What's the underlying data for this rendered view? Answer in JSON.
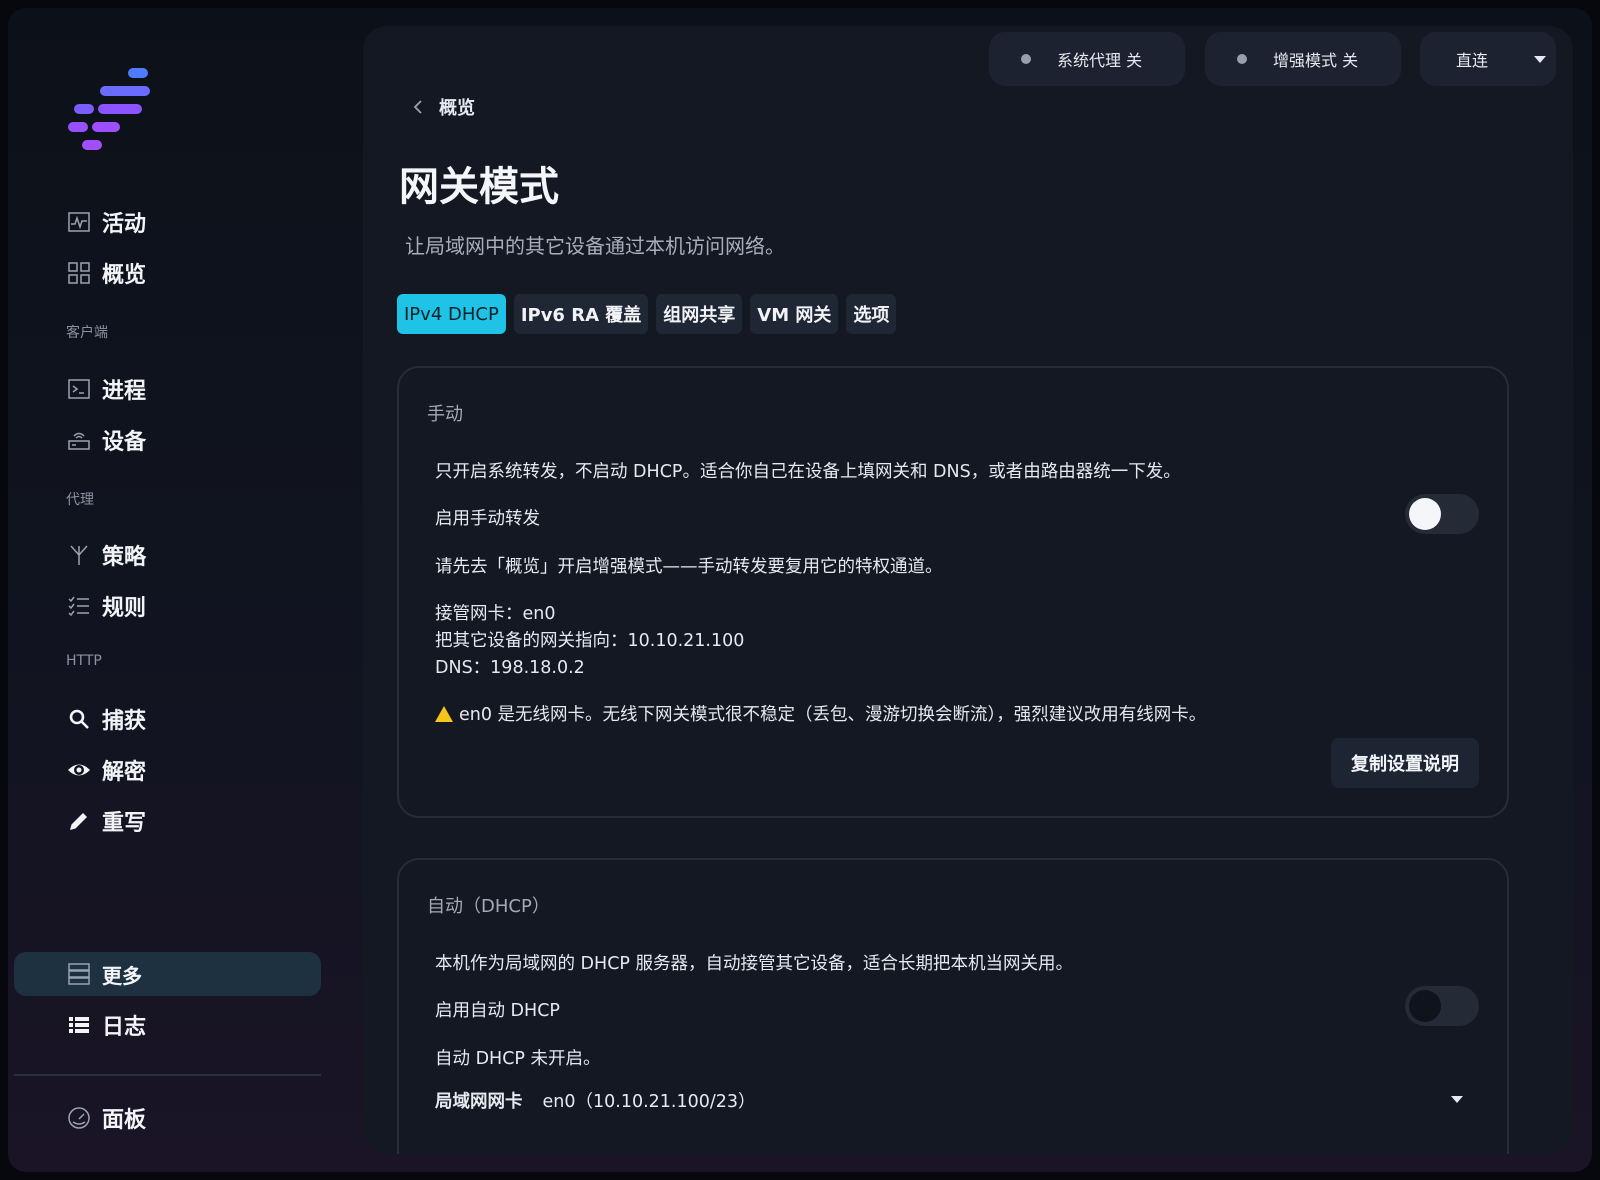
{
  "colors": {
    "accent": "#1ec3e6",
    "warning": "#f5c518",
    "logo": [
      "#4f7cff",
      "#7b5cff",
      "#a24dff"
    ]
  },
  "sidebar": {
    "items_top": [
      {
        "label": "活动",
        "icon": "activity-icon"
      },
      {
        "label": "概览",
        "icon": "grid-icon"
      }
    ],
    "section_client": "客户端",
    "items_client": [
      {
        "label": "进程",
        "icon": "terminal-icon"
      },
      {
        "label": "设备",
        "icon": "router-icon"
      }
    ],
    "section_proxy": "代理",
    "items_proxy": [
      {
        "label": "策略",
        "icon": "fork-icon"
      },
      {
        "label": "规则",
        "icon": "checklist-icon"
      }
    ],
    "section_http": "HTTP",
    "items_http": [
      {
        "label": "捕获",
        "icon": "search-icon"
      },
      {
        "label": "解密",
        "icon": "eye-icon"
      },
      {
        "label": "重写",
        "icon": "pencil-icon"
      }
    ],
    "items_bottom": [
      {
        "label": "更多",
        "icon": "server-icon",
        "active": true
      },
      {
        "label": "日志",
        "icon": "list-icon"
      }
    ],
    "footer_item": {
      "label": "面板",
      "icon": "gauge-icon"
    }
  },
  "topbar": {
    "system_proxy": "系统代理 关",
    "enhanced_mode": "增强模式 关",
    "mode_select": "直连"
  },
  "breadcrumb": {
    "back_label": "概览"
  },
  "page": {
    "title": "网关模式",
    "subtitle": "让局域网中的其它设备通过本机访问网络。"
  },
  "tabs": [
    {
      "label": "IPv4 DHCP",
      "active": true
    },
    {
      "label": "IPv6 RA 覆盖"
    },
    {
      "label": "组网共享"
    },
    {
      "label": "VM 网关"
    },
    {
      "label": "选项"
    }
  ],
  "manual": {
    "title": "手动",
    "description": "只开启系统转发，不启动 DHCP。适合你自己在设备上填网关和 DNS，或者由路由器统一下发。",
    "toggle_label": "启用手动转发",
    "toggle_on": false,
    "notice": "请先去「概览」开启增强模式——手动转发要复用它的特权通道。",
    "interface_line": "接管网卡：en0",
    "gateway_line": "把其它设备的网关指向：10.10.21.100",
    "dns_line": "DNS：198.18.0.2",
    "warning": "en0 是无线网卡。无线下网关模式很不稳定（丢包、漫游切换会断流），强烈建议改用有线网卡。",
    "copy_button": "复制设置说明"
  },
  "auto": {
    "title": "自动（DHCP）",
    "description": "本机作为局域网的 DHCP 服务器，自动接管其它设备，适合长期把本机当网关用。",
    "toggle_label": "启用自动 DHCP",
    "toggle_on": false,
    "status": "自动 DHCP 未开启。",
    "lan_label": "局域网网卡",
    "lan_value": "en0（10.10.21.100/23）"
  }
}
